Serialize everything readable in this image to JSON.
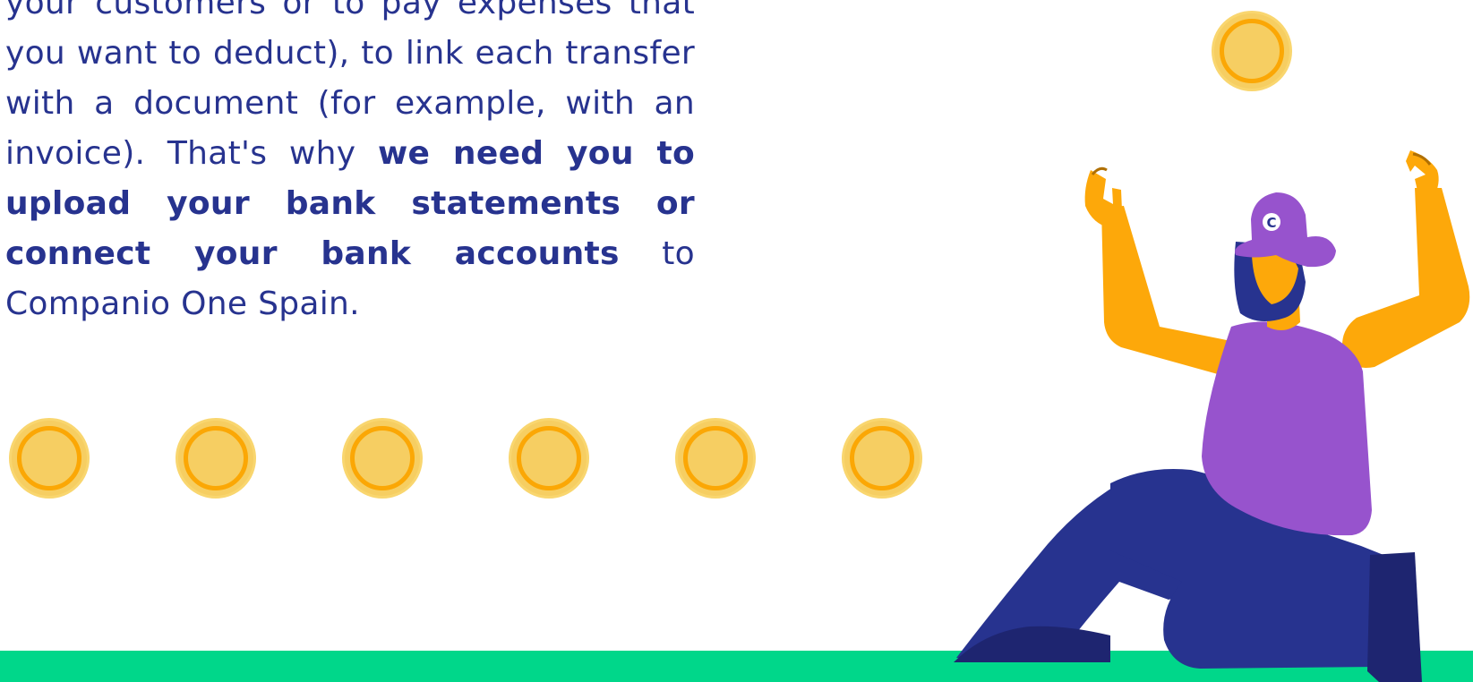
{
  "content": {
    "paragraph_part1": "your customers or to pay expenses that you want to deduct), to link each transfer with a document (for example, with an invoice). That's why ",
    "paragraph_bold": "we need you to upload your bank statements or connect your bank accounts",
    "paragraph_part2": " to Companio One Spain."
  },
  "illustration": {
    "cap_logo_letter": "C",
    "colors": {
      "text": "#27338f",
      "coin_fill": "#f6ce62",
      "coin_ring": "#fba705",
      "ground": "#00d78a",
      "skin": "#fda80a",
      "shirt": "#9753cd",
      "pants": "#27338f",
      "shoe": "#1e2570",
      "cap": "#9753cd"
    },
    "icons": [
      "coin-icon",
      "person-illustration"
    ]
  }
}
